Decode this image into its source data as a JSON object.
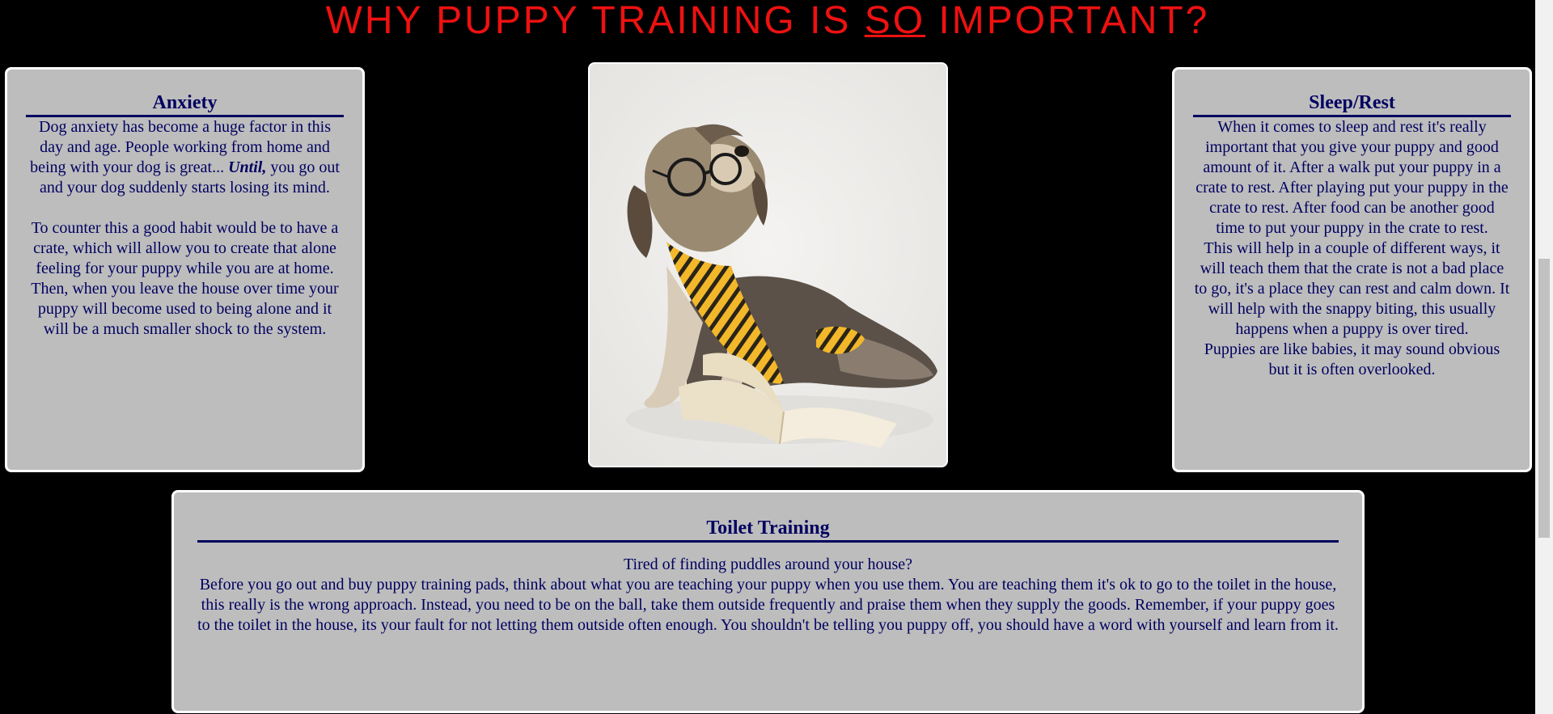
{
  "page": {
    "title_before": "WHY PUPPY TRAINING IS ",
    "title_emphasis": "SO",
    "title_after": " IMPORTANT?"
  },
  "anxiety": {
    "heading": "Anxiety",
    "p1_before": "Dog anxiety has become a huge factor in this day and age. People working from home and being with your dog is great... ",
    "p1_emphasis": "Until,",
    "p1_after": " you go out and your dog suddenly starts losing its mind.",
    "p2": "To counter this a good habit would be to have a crate, which will allow you to create that alone feeling for your puppy while you are at home. Then, when you leave the house over time your puppy will become used to being alone and it will be a much smaller shock to the system."
  },
  "sleep": {
    "heading": "Sleep/Rest",
    "p1": "When it comes to sleep and rest it's really important that you give your puppy and good amount of it. After a walk put your puppy in a crate to rest. After playing put your puppy in the crate to rest. After food can be another good time to put your puppy in the crate to rest.",
    "p2": "This will help in a couple of different ways, it will teach them that the crate is not a bad place to go, it's a place they can rest and calm down. It will help with the snappy biting, this usually happens when a puppy is over tired.",
    "p3": "Puppies are like babies, it may sound obvious but it is often overlooked."
  },
  "toilet": {
    "heading": "Toilet Training",
    "p1": "Tired of finding puddles around your house?",
    "p2": "Before you go out and buy puppy training pads, think about what you are teaching your puppy when you use them. You are teaching them it's ok to go to the toilet in the house, this really is the wrong approach. Instead, you need to be on the ball, take them outside frequently and praise them when they supply the goods. Remember, if your puppy goes to the toilet in the house, its your fault for not letting them outside often enough. You shouldn't be telling you puppy off, you should have a word with yourself and learn from it."
  },
  "colors": {
    "background": "#000000",
    "title": "#ee1111",
    "card_bg": "#bdbdbd",
    "card_text": "#000060"
  },
  "image": {
    "icon": "puppy-with-glasses-tie-book-photo"
  }
}
